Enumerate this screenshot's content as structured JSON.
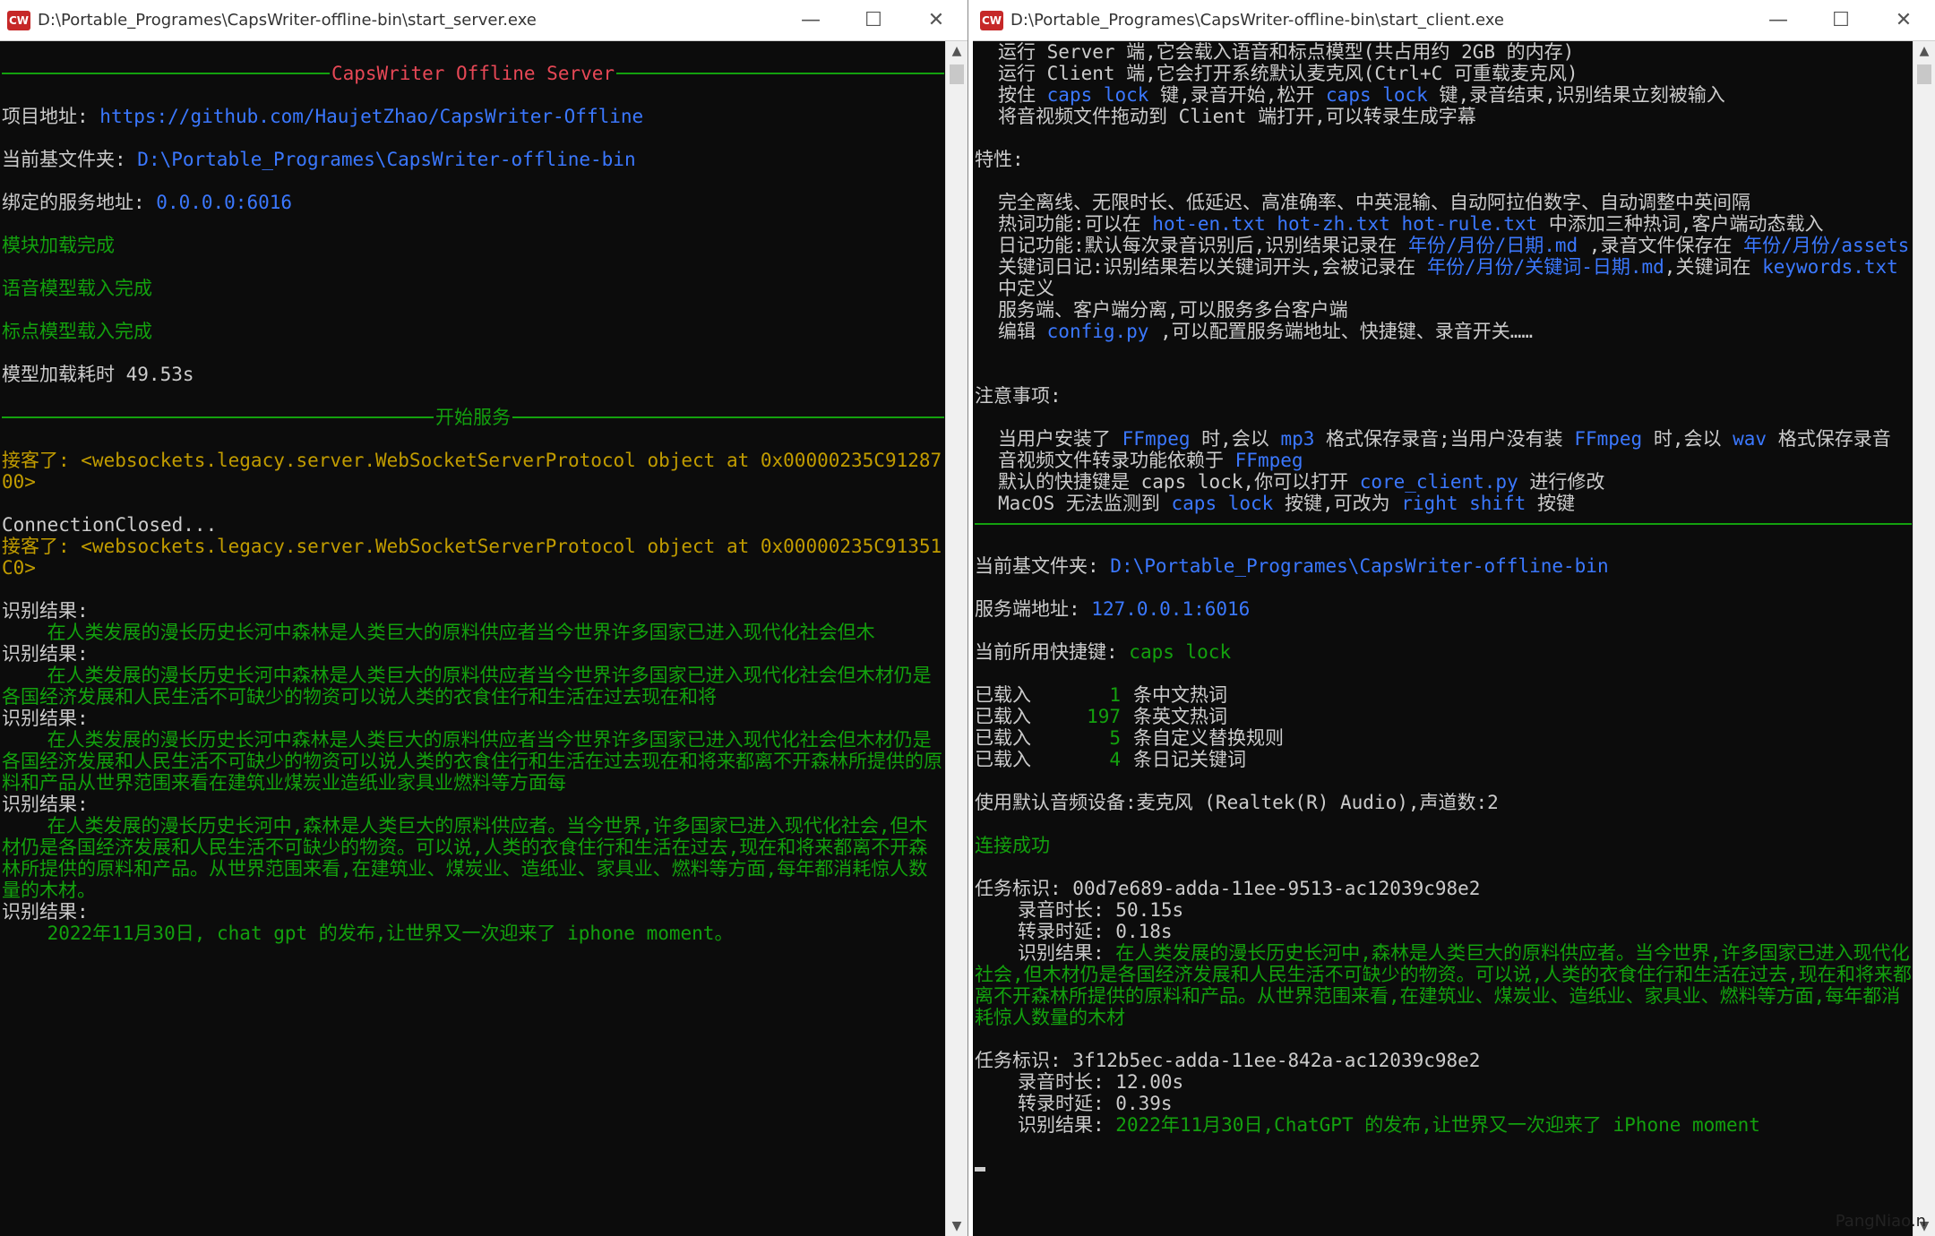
{
  "server": {
    "title": "D:\\Portable_Programes\\CapsWriter-offline-bin\\start_server.exe",
    "header_title": "CapsWriter Offline Server",
    "project_label": "项目地址: ",
    "project_url": "https://github.com/HaujetZhao/CapsWriter-Offline",
    "basedir_label": "当前基文件夹: ",
    "basedir": "D:\\Portable_Programes\\CapsWriter-offline-bin",
    "bind_label": "绑定的服务地址: ",
    "bind_addr": "0.0.0.0:6016",
    "module_loaded": "模块加载完成",
    "speech_loaded": "语音模型载入完成",
    "punc_loaded": "标点模型载入完成",
    "load_time": "模型加载耗时 49.53s",
    "start_service": "开始服务",
    "conn1": "接客了: <websockets.legacy.server.WebSocketServerProtocol object at 0x00000235C9128700>",
    "closed": "ConnectionClosed...",
    "conn2": "接客了: <websockets.legacy.server.WebSocketServerProtocol object at 0x00000235C91351C0>",
    "result_label": "识别结果:",
    "results": [
      "    在人类发展的漫长历史长河中森林是人类巨大的原料供应者当今世界许多国家已进入现代化社会但木",
      "    在人类发展的漫长历史长河中森林是人类巨大的原料供应者当今世界许多国家已进入现代化社会但木材仍是各国经济发展和人民生活不可缺少的物资可以说人类的衣食住行和生活在过去现在和将",
      "    在人类发展的漫长历史长河中森林是人类巨大的原料供应者当今世界许多国家已进入现代化社会但木材仍是各国经济发展和人民生活不可缺少的物资可以说人类的衣食住行和生活在过去现在和将来都离不开森林所提供的原料和产品从世界范围来看在建筑业煤炭业造纸业家具业燃料等方面每",
      "    在人类发展的漫长历史长河中,森林是人类巨大的原料供应者。当今世界,许多国家已进入现代化社会,但木材仍是各国经济发展和人民生活不可缺少的物资。可以说,人类的衣食住行和生活在过去,现在和将来都离不开森林所提供的原料和产品。从世界范围来看,在建筑业、煤炭业、造纸业、家具业、燃料等方面,每年都消耗惊人数量的木材。",
      "    2022年11月30日, chat gpt 的发布,让世界又一次迎来了 iphone moment。"
    ]
  },
  "client": {
    "title": "D:\\Portable_Programes\\CapsWriter-offline-bin\\start_client.exe",
    "usage": [
      [
        {
          "t": "运行 Server 端,它会载入语音和标点模型(共占用约 2GB 的内存)",
          "c": "white"
        }
      ],
      [
        {
          "t": "运行 Client 端,它会打开系统默认麦克风(Ctrl+C 可重载麦克风)",
          "c": "white"
        }
      ],
      [
        {
          "t": "按住 ",
          "c": "white"
        },
        {
          "t": "caps lock",
          "c": "blue"
        },
        {
          "t": " 键,录音开始,松开 ",
          "c": "white"
        },
        {
          "t": "caps lock",
          "c": "blue"
        },
        {
          "t": " 键,录音结束,识别结果立刻被输入",
          "c": "white"
        }
      ],
      [
        {
          "t": "将音视频文件拖动到 Client 端打开,可以转录生成字幕",
          "c": "white"
        }
      ]
    ],
    "features_label": "特性:",
    "features": [
      [
        {
          "t": "完全离线、无限时长、低延迟、高准确率、中英混输、自动阿拉伯数字、自动调整中英间隔",
          "c": "white"
        }
      ],
      [
        {
          "t": "热词功能:可以在 ",
          "c": "white"
        },
        {
          "t": "hot-en.txt hot-zh.txt hot-rule.txt",
          "c": "blue"
        },
        {
          "t": " 中添加三种热词,客户端动态载入",
          "c": "white"
        }
      ],
      [
        {
          "t": "日记功能:默认每次录音识别后,识别结果记录在 ",
          "c": "white"
        },
        {
          "t": "年份/月份/日期.md",
          "c": "blue"
        },
        {
          "t": " ,录音文件保存在 ",
          "c": "white"
        },
        {
          "t": "年份/月份/assets",
          "c": "blue"
        }
      ],
      [
        {
          "t": "关键词日记:识别结果若以关键词开头,会被记录在 ",
          "c": "white"
        },
        {
          "t": "年份/月份/关键词-日期.md",
          "c": "blue"
        },
        {
          "t": ",关键词在 ",
          "c": "white"
        },
        {
          "t": "keywords.txt",
          "c": "blue"
        },
        {
          "t": " 中定义",
          "c": "white"
        }
      ],
      [
        {
          "t": "服务端、客户端分离,可以服务多台客户端",
          "c": "white"
        }
      ],
      [
        {
          "t": "编辑 ",
          "c": "white"
        },
        {
          "t": "config.py",
          "c": "blue"
        },
        {
          "t": " ,可以配置服务端地址、快捷键、录音开关……",
          "c": "white"
        }
      ]
    ],
    "notes_label": "注意事项:",
    "notes": [
      [
        {
          "t": "当用户安装了 ",
          "c": "white"
        },
        {
          "t": "FFmpeg",
          "c": "blue"
        },
        {
          "t": " 时,会以 ",
          "c": "white"
        },
        {
          "t": "mp3",
          "c": "blue"
        },
        {
          "t": " 格式保存录音;当用户没有装 ",
          "c": "white"
        },
        {
          "t": "FFmpeg",
          "c": "blue"
        },
        {
          "t": " 时,会以 ",
          "c": "white"
        },
        {
          "t": "wav",
          "c": "blue"
        },
        {
          "t": " 格式保存录音",
          "c": "white"
        }
      ],
      [
        {
          "t": "音视频文件转录功能依赖于 ",
          "c": "white"
        },
        {
          "t": "FFmpeg",
          "c": "blue"
        }
      ],
      [
        {
          "t": "默认的快捷键是 caps lock,你可以打开 ",
          "c": "white"
        },
        {
          "t": "core_client.py",
          "c": "blue"
        },
        {
          "t": " 进行修改",
          "c": "white"
        }
      ],
      [
        {
          "t": "MacOS 无法监测到 ",
          "c": "white"
        },
        {
          "t": "caps lock",
          "c": "blue"
        },
        {
          "t": " 按键,可改为 ",
          "c": "white"
        },
        {
          "t": "right shift",
          "c": "blue"
        },
        {
          "t": " 按键",
          "c": "white"
        }
      ]
    ],
    "basedir_label": "当前基文件夹: ",
    "basedir": "D:\\Portable_Programes\\CapsWriter-offline-bin",
    "server_label": "服务端地址: ",
    "server_addr": "127.0.0.1:6016",
    "hotkey_label": "当前所用快捷键: ",
    "hotkey": "caps lock",
    "loaded": [
      {
        "pre": "已载入",
        "n": "1",
        "post": "条中文热词"
      },
      {
        "pre": "已载入",
        "n": "197",
        "post": "条英文热词"
      },
      {
        "pre": "已载入",
        "n": "5",
        "post": "条自定义替换规则"
      },
      {
        "pre": "已载入",
        "n": "4",
        "post": "条日记关键词"
      }
    ],
    "device": "使用默认音频设备:麦克风 (Realtek(R) Audio),声道数:2",
    "connected": "连接成功",
    "tasks": [
      {
        "id_label": "任务标识: ",
        "id": "00d7e689-adda-11ee-9513-ac12039c98e2",
        "dur_label": "录音时长: ",
        "dur": "50.15s",
        "lat_label": "转录时延: ",
        "lat": "0.18s",
        "res_label": "识别结果: ",
        "res": "在人类发展的漫长历史长河中,森林是人类巨大的原料供应者。当今世界,许多国家已进入现代化社会,但木材仍是各国经济发展和人民生活不可缺少的物资。可以说,人类的衣食住行和生活在过去,现在和将来都离不开森林所提供的原料和产品。从世界范围来看,在建筑业、煤炭业、造纸业、家具业、燃料等方面,每年都消耗惊人数量的木材"
      },
      {
        "id_label": "任务标识: ",
        "id": "3f12b5ec-adda-11ee-842a-ac12039c98e2",
        "dur_label": "录音时长: ",
        "dur": "12.00s",
        "lat_label": "转录时延: ",
        "lat": "0.39s",
        "res_label": "识别结果: ",
        "res": "2022年11月30日,ChatGPT 的发布,让世界又一次迎来了 iPhone moment"
      }
    ]
  },
  "watermark": "PangNiao.n",
  "colors": {
    "green": "#13a10e",
    "blue": "#3b78ff",
    "red": "#e74856",
    "yellow": "#c19c00",
    "bg": "#0c0c0c"
  }
}
